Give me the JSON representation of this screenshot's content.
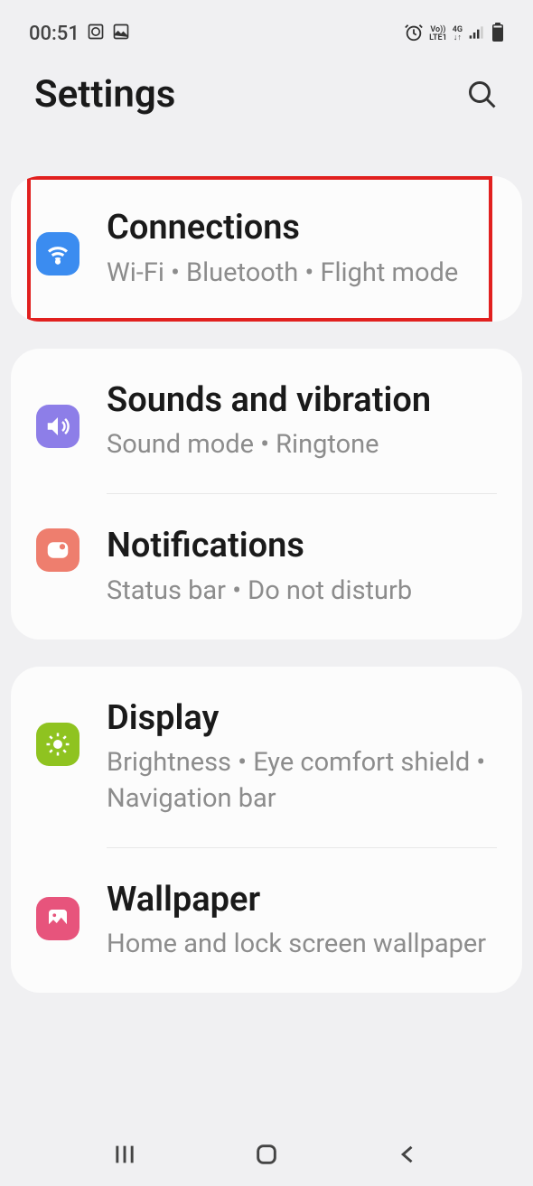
{
  "status_bar": {
    "time": "00:51"
  },
  "header": {
    "title": "Settings"
  },
  "groups": [
    {
      "highlighted": true,
      "items": [
        {
          "icon": "wifi",
          "icon_color": "blue",
          "title": "Connections",
          "subtitle": "Wi-Fi  •  Bluetooth  •  Flight mode"
        }
      ]
    },
    {
      "items": [
        {
          "icon": "sound",
          "icon_color": "purple",
          "title": "Sounds and vibration",
          "subtitle": "Sound mode  •  Ringtone"
        },
        {
          "icon": "notifications",
          "icon_color": "coral",
          "title": "Notifications",
          "subtitle": "Status bar  •  Do not disturb"
        }
      ]
    },
    {
      "items": [
        {
          "icon": "display",
          "icon_color": "green",
          "title": "Display",
          "subtitle": "Brightness  •  Eye comfort shield  •  Navigation bar"
        },
        {
          "icon": "wallpaper",
          "icon_color": "pink",
          "title": "Wallpaper",
          "subtitle": "Home and lock screen wallpaper"
        }
      ]
    }
  ]
}
